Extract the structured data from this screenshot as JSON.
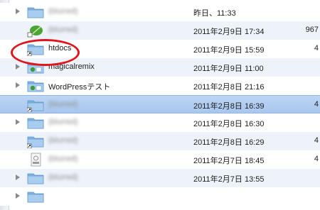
{
  "colors": {
    "folder_top": "#a9cdee",
    "folder_body": "#7fb3e3",
    "annotation": "#e0161c",
    "selection": "#b3cff2"
  },
  "rows": [
    {
      "name": "(blurred)",
      "blurred": true,
      "icon": "folder-icon",
      "date": "昨日、11:33",
      "size": "",
      "disclosure": true
    },
    {
      "name": "(blurred)",
      "blurred": true,
      "icon": "leaf-document-icon",
      "date": "2011年2月9日 17:34",
      "size": "967",
      "disclosure": false
    },
    {
      "name": "htdocs",
      "blurred": false,
      "icon": "folder-alias-icon",
      "date": "2011年2月9日 15:59",
      "size": "4",
      "disclosure": false
    },
    {
      "name": "magicalremix",
      "blurred": false,
      "icon": "website-folder-icon",
      "date": "2011年2月9日 11:00",
      "size": "",
      "disclosure": true
    },
    {
      "name": "WordPressテスト",
      "blurred": false,
      "icon": "website-folder-icon",
      "date": "2011年2月8日 21:16",
      "size": "",
      "disclosure": true
    },
    {
      "name": "(blurred)",
      "blurred": true,
      "icon": "folder-alias-icon",
      "date": "2011年2月8日 16:39",
      "size": "4",
      "disclosure": false,
      "selected": true
    },
    {
      "name": "(blurred)",
      "blurred": true,
      "icon": "folder-icon",
      "date": "2011年2月8日 16:30",
      "size": "",
      "disclosure": true
    },
    {
      "name": "(blurred)",
      "blurred": true,
      "icon": "folder-alias-icon",
      "date": "2011年2月8日 16:29",
      "size": "4",
      "disclosure": false
    },
    {
      "name": "(blurred)",
      "blurred": true,
      "icon": "text-document-icon",
      "date": "2011年2月7日 18:45",
      "size": "4",
      "disclosure": false
    },
    {
      "name": "(blurred)",
      "blurred": true,
      "icon": "folder-icon",
      "date": "2011年2月7日 13:55",
      "size": "",
      "disclosure": true
    },
    {
      "name": "",
      "blurred": true,
      "icon": "folder-icon",
      "date": "",
      "size": "",
      "disclosure": true
    }
  ]
}
